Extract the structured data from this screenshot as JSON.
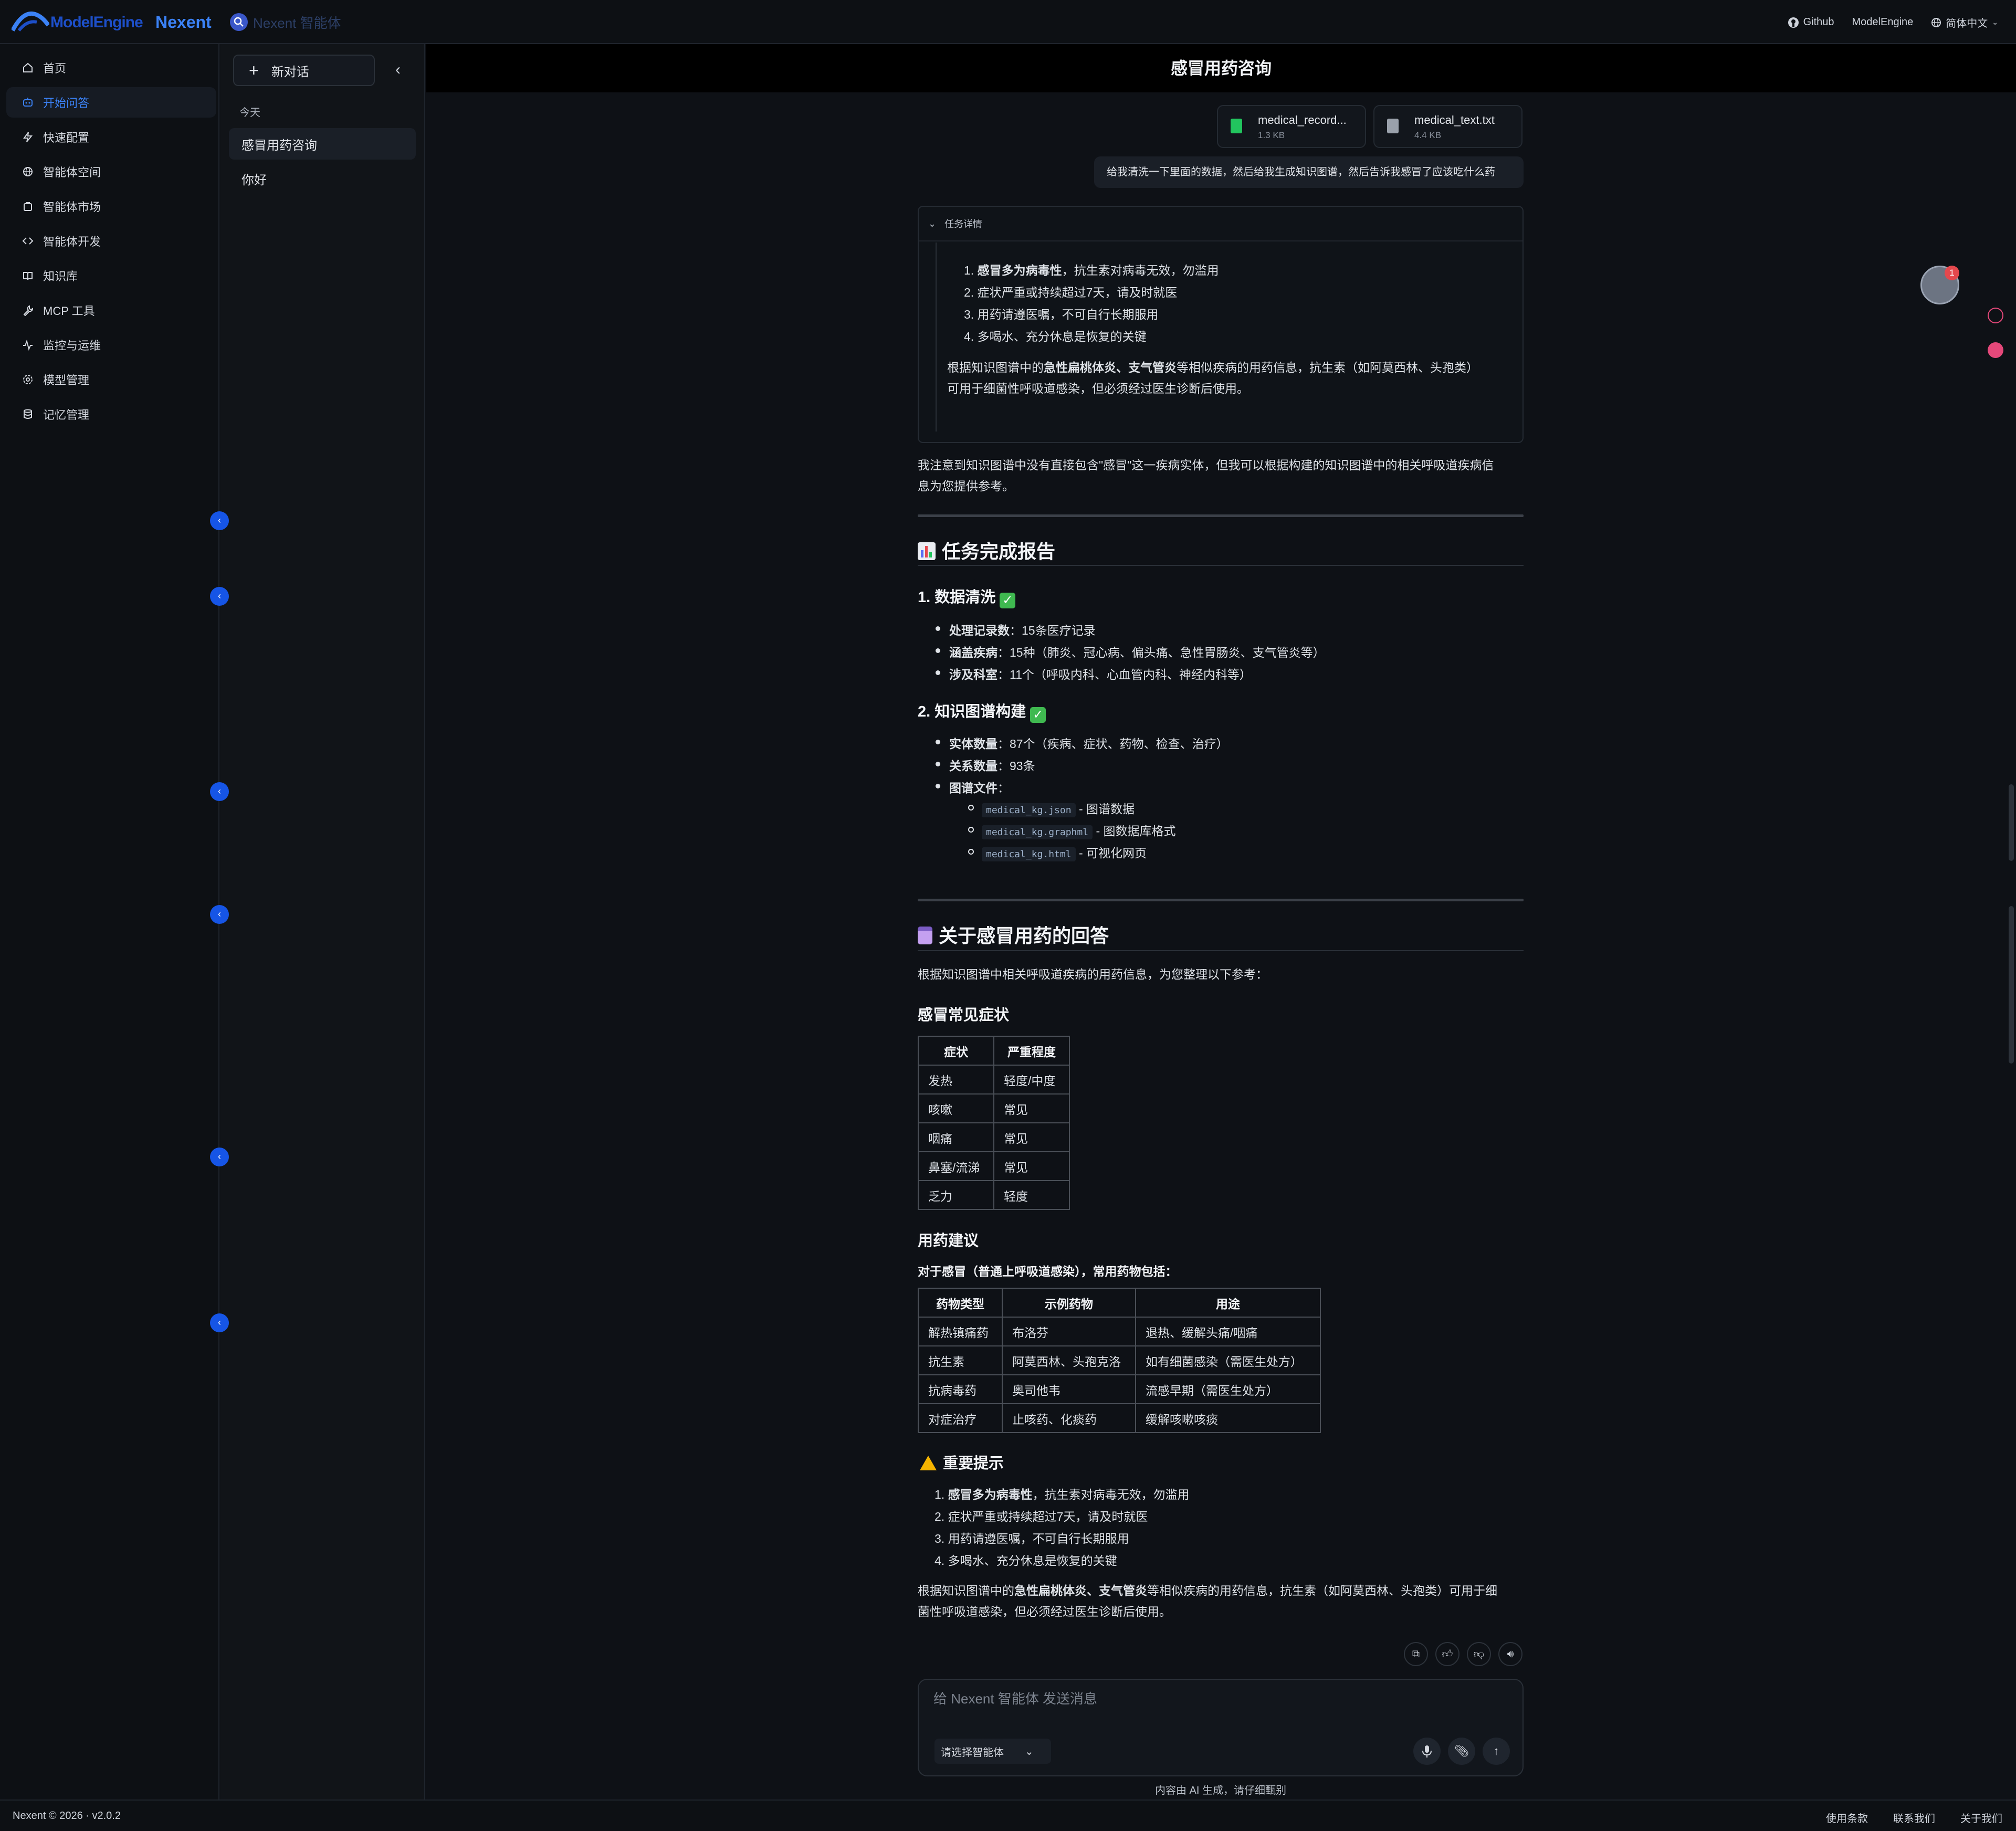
{
  "topbar": {
    "logo_text": "ModelEngine",
    "brand": "Nexent",
    "agent_tag": "Nexent 智能体",
    "links": [
      "Github",
      "ModelEngine",
      "简体中文"
    ]
  },
  "nav": {
    "items": [
      {
        "label": "首页",
        "icon": "home-icon"
      },
      {
        "label": "开始问答",
        "icon": "chat-bot-icon",
        "active": true
      },
      {
        "label": "快速配置",
        "icon": "bolt-icon"
      },
      {
        "label": "智能体空间",
        "icon": "globe-icon"
      },
      {
        "label": "智能体市场",
        "icon": "store-icon"
      },
      {
        "label": "智能体开发",
        "icon": "code-icon"
      },
      {
        "label": "知识库",
        "icon": "book-icon"
      },
      {
        "label": "MCP 工具",
        "icon": "wrench-icon"
      },
      {
        "label": "监控与运维",
        "icon": "pulse-icon"
      },
      {
        "label": "模型管理",
        "icon": "gear-icon"
      },
      {
        "label": "记忆管理",
        "icon": "database-icon"
      }
    ]
  },
  "conversations": {
    "new_chat": "新对话",
    "group_label": "今天",
    "items": [
      "感冒用药咨询",
      "你好"
    ]
  },
  "chat": {
    "title": "感冒用药咨询",
    "files": [
      {
        "name": "medical_record...",
        "size": "1.3 KB",
        "icon": "excel-file-icon",
        "color": "#22c55e"
      },
      {
        "name": "medical_text.txt",
        "size": "4.4 KB",
        "icon": "text-file-icon",
        "color": "#9aa1ab"
      }
    ],
    "user_message": "给我清洗一下里面的数据，然后给我生成知识图谱，然后告诉我感冒了应该吃什么药",
    "task_details_label": "任务详情",
    "task_list": [
      {
        "bold": "感冒多为病毒性",
        "rest": "，抗生素对病毒无效，勿滥用"
      },
      {
        "bold": "",
        "rest": "症状严重或持续超过7天，请及时就医"
      },
      {
        "bold": "",
        "rest": "用药请遵医嘱，不可自行长期服用"
      },
      {
        "bold": "",
        "rest": "多喝水、充分休息是恢复的关键"
      }
    ],
    "task_para": {
      "pre": "根据知识图谱中的",
      "bold": "急性扁桃体炎、支气管炎",
      "post1": "等相似疾病的用药信息，抗生素（如阿莫西林、头孢类）",
      "post2": "可用于细菌性呼吸道感染，但必须经过医生诊断后使用。"
    },
    "note_line1": "我注意到知识图谱中没有直接包含\"感冒\"这一疾病实体，但我可以根据构建的知识图谱中的相关呼吸道疾病信",
    "note_line2": "息为您提供参考。",
    "report": {
      "heading": "任务完成报告",
      "section1_title": "1. 数据清洗",
      "section1_items": [
        {
          "label": "处理记录数",
          "value": "：15条医疗记录"
        },
        {
          "label": "涵盖疾病",
          "value": "：15种（肺炎、冠心病、偏头痛、急性胃肠炎、支气管炎等）"
        },
        {
          "label": "涉及科室",
          "value": "：11个（呼吸内科、心血管内科、神经内科等）"
        }
      ],
      "section2_title": "2. 知识图谱构建",
      "section2_items": [
        {
          "label": "实体数量",
          "value": "：87个（疾病、症状、药物、检查、治疗）"
        },
        {
          "label": "关系数量",
          "value": "：93条"
        },
        {
          "label": "图谱文件",
          "value": "："
        }
      ],
      "files": [
        {
          "code": "medical_kg.json",
          "desc": " - 图谱数据"
        },
        {
          "code": "medical_kg.graphml",
          "desc": " - 图数据库格式"
        },
        {
          "code": "medical_kg.html",
          "desc": " - 可视化网页"
        }
      ]
    },
    "answer": {
      "heading": "关于感冒用药的回答",
      "intro": "根据知识图谱中相关呼吸道疾病的用药信息，为您整理以下参考：",
      "symptoms_title": "感冒常见症状",
      "symptoms_headers": [
        "症状",
        "严重程度"
      ],
      "symptoms_rows": [
        [
          "发热",
          "轻度/中度"
        ],
        [
          "咳嗽",
          "常见"
        ],
        [
          "咽痛",
          "常见"
        ],
        [
          "鼻塞/流涕",
          "常见"
        ],
        [
          "乏力",
          "轻度"
        ]
      ],
      "meds_title": "用药建议",
      "meds_intro": "对于感冒（普通上呼吸道感染），常用药物包括：",
      "meds_headers": [
        "药物类型",
        "示例药物",
        "用途"
      ],
      "meds_rows": [
        [
          "解热镇痛药",
          "布洛芬",
          "退热、缓解头痛/咽痛"
        ],
        [
          "抗生素",
          "阿莫西林、头孢克洛",
          "如有细菌感染（需医生处方）"
        ],
        [
          "抗病毒药",
          "奥司他韦",
          "流感早期（需医生处方）"
        ],
        [
          "对症治疗",
          "止咳药、化痰药",
          "缓解咳嗽咳痰"
        ]
      ],
      "warning_title": "重要提示",
      "warning_items": [
        {
          "bold": "感冒多为病毒性",
          "rest": "，抗生素对病毒无效，勿滥用"
        },
        {
          "bold": "",
          "rest": "症状严重或持续超过7天，请及时就医"
        },
        {
          "bold": "",
          "rest": "用药请遵医嘱，不可自行长期服用"
        },
        {
          "bold": "",
          "rest": "多喝水、充分休息是恢复的关键"
        }
      ],
      "final_pre": "根据知识图谱中的",
      "final_bold": "急性扁桃体炎、支气管炎",
      "final_post1": "等相似疾病的用药信息，抗生素（如阿莫西林、头孢类）可用于细",
      "final_post2": "菌性呼吸道感染，但必须经过医生诊断后使用。"
    }
  },
  "input": {
    "placeholder": "给 Nexent 智能体 发送消息",
    "agent_select": "请选择智能体",
    "disclaimer": "内容由 AI 生成，请仔细甄别"
  },
  "float": {
    "badge_count": "1"
  },
  "footer": {
    "copyright": "Nexent © 2026 · v2.0.2",
    "links": [
      "使用条款",
      "联系我们",
      "关于我们"
    ]
  }
}
